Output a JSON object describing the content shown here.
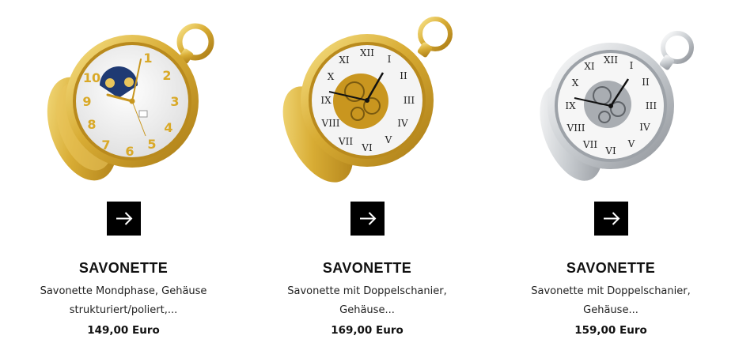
{
  "products": [
    {
      "title": "SAVONETTE",
      "description": "Savonette Mondphase, Gehäuse strukturiert/poliert,...",
      "price": "149,00 Euro",
      "image": "gold-pocket-watch-moonphase",
      "button_icon": "arrow-right-icon",
      "metal_color": "#d9b23a",
      "dial_numeral_color": "#d9a928"
    },
    {
      "title": "SAVONETTE",
      "description": "Savonette mit Doppelschanier, Gehäuse...",
      "price": "169,00 Euro",
      "image": "gold-skeleton-pocket-watch",
      "button_icon": "arrow-right-icon",
      "metal_color": "#d9b23a"
    },
    {
      "title": "SAVONETTE",
      "description": "Savonette mit Doppelschanier, Gehäuse...",
      "price": "159,00 Euro",
      "image": "silver-skeleton-pocket-watch",
      "button_icon": "arrow-right-icon",
      "metal_color": "#c8ccd0"
    }
  ],
  "colors": {
    "button_bg": "#000000",
    "button_icon": "#ffffff",
    "text": "#111111"
  }
}
